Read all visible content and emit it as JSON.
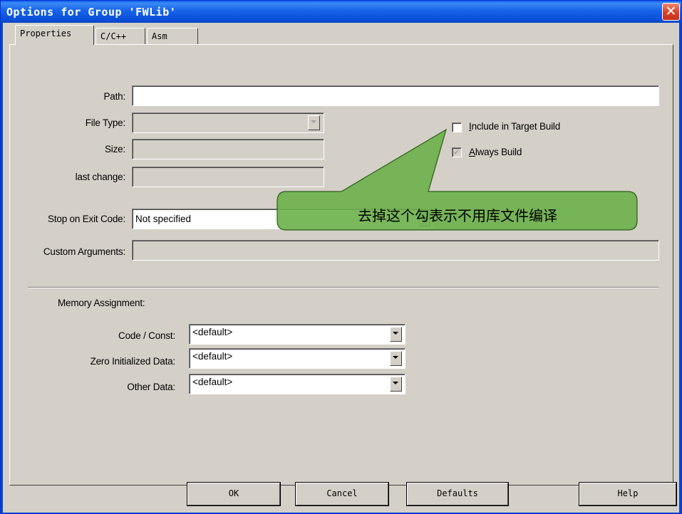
{
  "window": {
    "title": "Options for Group 'FWLib'",
    "close_glyph": "✕"
  },
  "tabs": [
    {
      "label": "Properties",
      "active": true
    },
    {
      "label": "C/C++",
      "active": false
    },
    {
      "label": "Asm",
      "active": false
    }
  ],
  "properties": {
    "path_label": "Path:",
    "path_value": "",
    "file_type_label": "File Type:",
    "file_type_value": "",
    "size_label": "Size:",
    "size_value": "",
    "last_change_label": "last change:",
    "last_change_value": "",
    "stop_on_exit_label": "Stop on Exit Code:",
    "stop_on_exit_value": "Not specified",
    "custom_args_label": "Custom Arguments:",
    "custom_args_value": "",
    "include_target_build": {
      "first": "I",
      "rest": "nclude in Target Build",
      "checked": false
    },
    "always_build": {
      "first": "A",
      "rest": "lways Build",
      "checked": true,
      "disabled": true
    }
  },
  "memory": {
    "heading": "Memory Assignment:",
    "code_const_label": "Code / Const:",
    "code_const_value": "<default>",
    "zero_init_label": "Zero Initialized Data:",
    "zero_init_value": "<default>",
    "other_data_label": "Other Data:",
    "other_data_value": "<default>"
  },
  "callout": {
    "text": "去掉这个勾表示不用库文件编译",
    "fill": "#6bb04a",
    "stroke": "#2d5a1a"
  },
  "buttons": {
    "ok": "OK",
    "cancel": "Cancel",
    "defaults": "Defaults",
    "help": "Help"
  }
}
